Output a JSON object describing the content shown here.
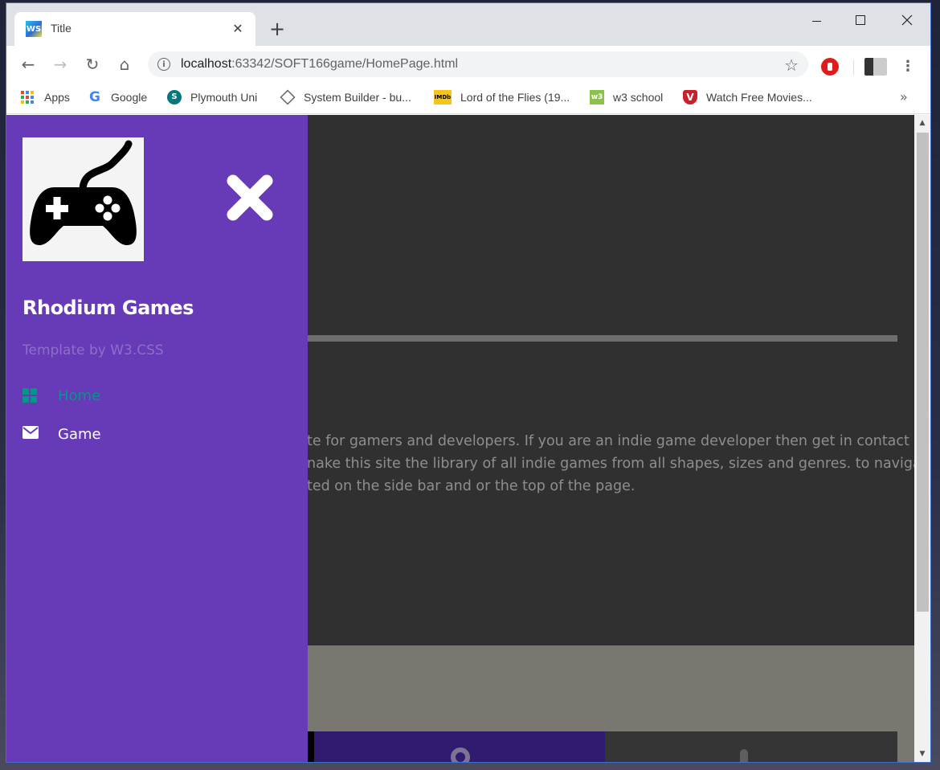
{
  "browser": {
    "tab": {
      "favicon_label": "WS",
      "title": "Title",
      "close_glyph": "✕"
    },
    "new_tab_glyph": "+",
    "address_bar": {
      "host": "localhost",
      "path": ":63342/SOFT166game/HomePage.html"
    },
    "bookmarks": [
      {
        "label": "Apps",
        "icon": "apps-grid-icon"
      },
      {
        "label": "Google",
        "icon": "google-icon"
      },
      {
        "label": "Plymouth Uni",
        "icon": "sharepoint-icon"
      },
      {
        "label": "System Builder - bu...",
        "icon": "box-icon"
      },
      {
        "label": "Lord of the Flies (19...",
        "icon": "imdb-icon"
      },
      {
        "label": "w3 school",
        "icon": "w3-icon"
      },
      {
        "label": "Watch Free Movies...",
        "icon": "vimeo-icon"
      }
    ],
    "bookmarks_overflow": "»",
    "icons": {
      "back": "←",
      "forward": "→",
      "reload": "↻",
      "home": "⌂",
      "info": "i",
      "star": "☆",
      "menu": "⋮"
    }
  },
  "sidebar": {
    "brand": "Rhodium Games",
    "credit": "Template by W3.CSS",
    "nav": [
      {
        "label": "Home",
        "icon": "grid-icon",
        "active": true
      },
      {
        "label": "Game",
        "icon": "envelope-icon",
        "active": false
      }
    ]
  },
  "page": {
    "intro_lines": [
      "te for gamers and developers. If you are an indie game developer then get in contact to",
      "nake this site the library of all indie games from all shapes, sizes and genres. to navigate",
      "ted on the side bar and or the top of the page."
    ]
  },
  "colors": {
    "sidebar_bg": "#673ab7",
    "active_nav": "#009688",
    "page_bg": "#303030",
    "card_purple": "#301b6e"
  }
}
